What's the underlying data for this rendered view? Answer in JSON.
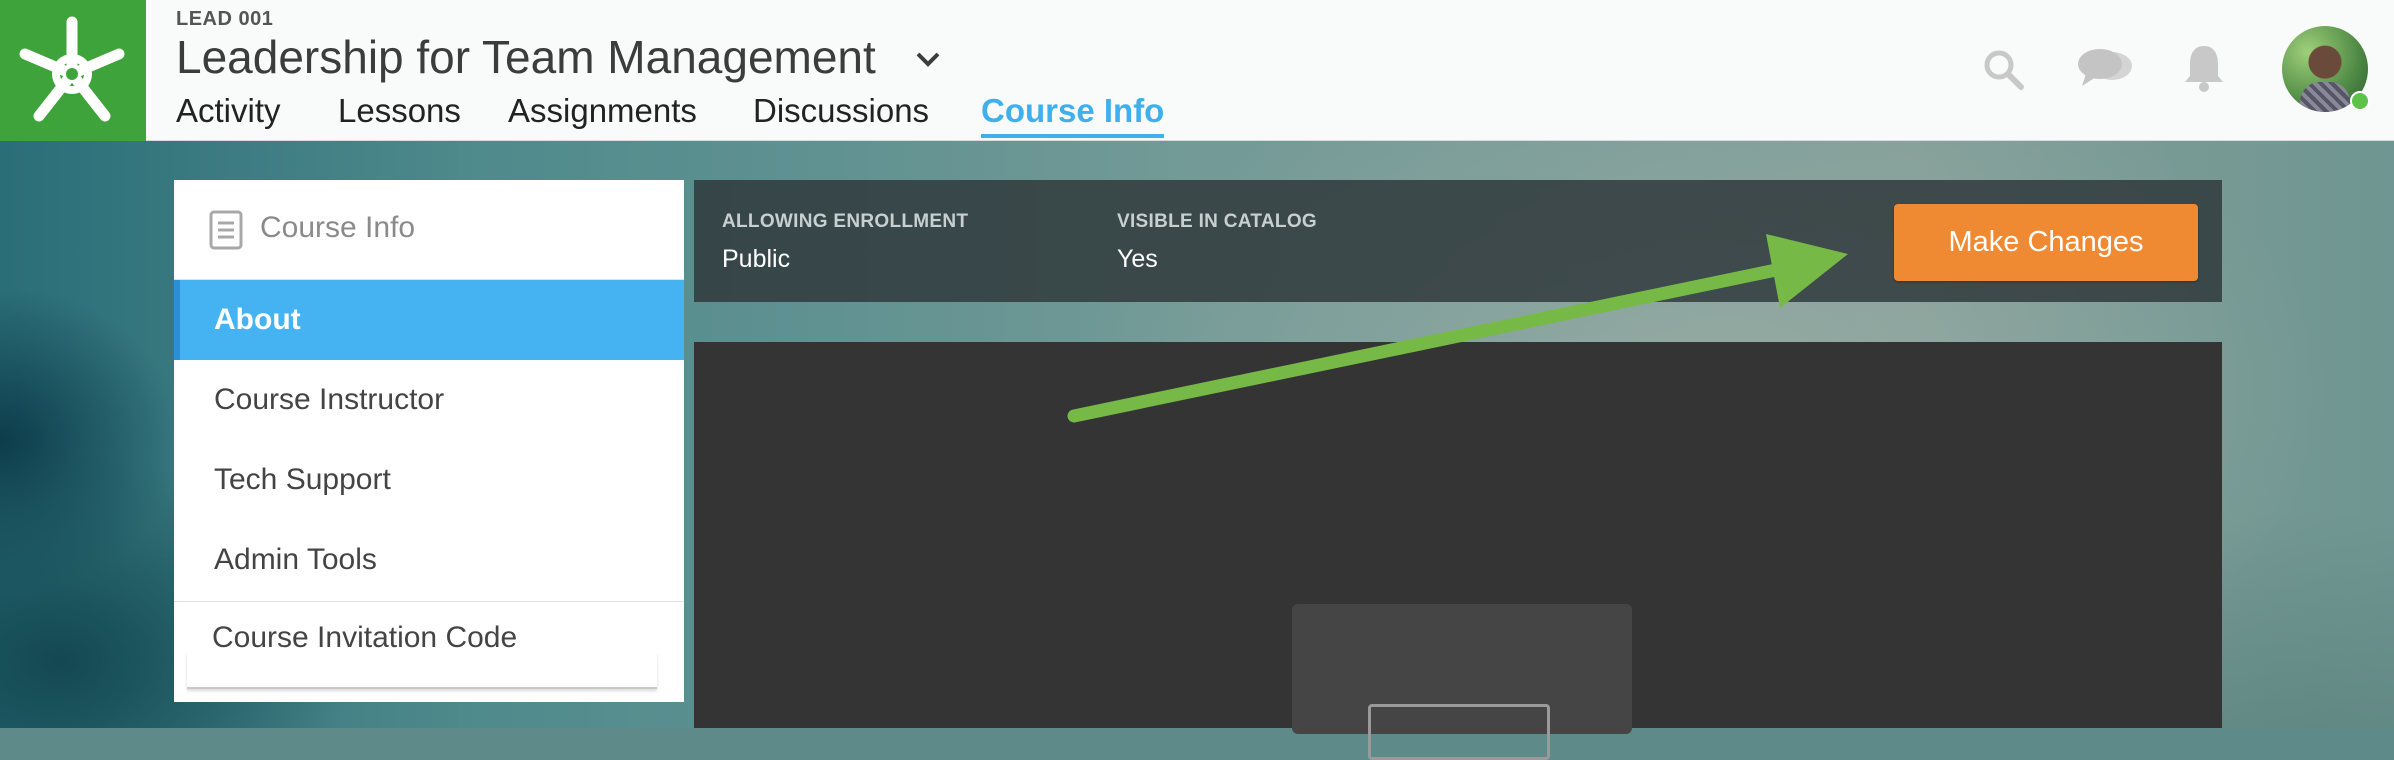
{
  "header": {
    "course_code": "LEAD 001",
    "course_title": "Leadership for Team Management",
    "tabs": [
      {
        "label": "Activity"
      },
      {
        "label": "Lessons"
      },
      {
        "label": "Assignments"
      },
      {
        "label": "Discussions"
      },
      {
        "label": "Course Info",
        "active": true
      }
    ],
    "icons": [
      "search-icon",
      "chat-icon",
      "bell-icon"
    ],
    "brand_color": "#3fa33b",
    "accent_color": "#3fb0ec"
  },
  "sidebar": {
    "title": "Course Info",
    "items": [
      {
        "label": "About",
        "active": true
      },
      {
        "label": "Course Instructor"
      },
      {
        "label": "Tech Support"
      },
      {
        "label": "Admin Tools"
      }
    ],
    "invitation_code_label": "Course Invitation Code"
  },
  "info_bar": {
    "enrollment_label": "ALLOWING ENROLLMENT",
    "enrollment_value": "Public",
    "catalog_label": "VISIBLE IN CATALOG",
    "catalog_value": "Yes",
    "make_changes_label": "Make Changes",
    "button_color": "#ef8a33"
  },
  "annotation": {
    "arrow_color": "#76b947"
  }
}
